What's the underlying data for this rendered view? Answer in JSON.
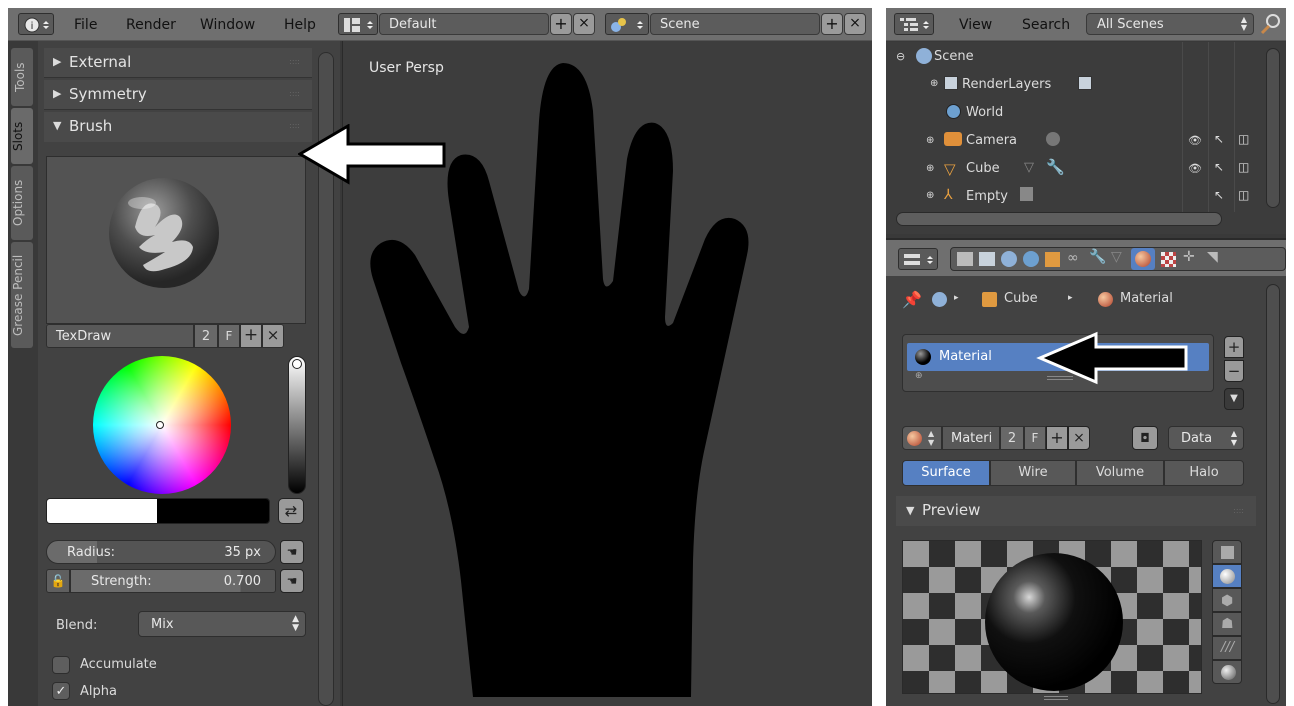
{
  "left_window": {
    "menu": [
      "File",
      "Render",
      "Window",
      "Help"
    ],
    "layout_name": "Default",
    "scene_name": "Scene",
    "tool_tabs": [
      "Tools",
      "Slots",
      "Options",
      "Grease Pencil"
    ],
    "panels": {
      "external": "External",
      "symmetry": "Symmetry",
      "brush": "Brush"
    },
    "brush": {
      "name": "TexDraw",
      "users": "2",
      "fake_user": "F",
      "radius_label": "Radius:",
      "radius_value": "35 px",
      "strength_label": "Strength:",
      "strength_value": "0.700",
      "blend_label": "Blend:",
      "blend_value": "Mix",
      "accumulate_label": "Accumulate",
      "alpha_label": "Alpha"
    },
    "viewport_label": "User Persp"
  },
  "right_window": {
    "outliner_menu": [
      "View",
      "Search"
    ],
    "outliner_filter": "All Scenes",
    "outliner_items": {
      "scene": "Scene",
      "renderlayers": "RenderLayers",
      "world": "World",
      "camera": "Camera",
      "cube": "Cube",
      "empty": "Empty"
    },
    "breadcrumb": {
      "object": "Cube",
      "material": "Material"
    },
    "material_slot": "Material",
    "material_datablock": {
      "name": "Materi",
      "users": "2",
      "fake_user": "F",
      "link": "Data"
    },
    "material_tabs": [
      "Surface",
      "Wire",
      "Volume",
      "Halo"
    ],
    "preview_title": "Preview"
  },
  "colors": {
    "header_bg": "#6f6f6f",
    "panel_bg": "#393939",
    "viewport_bg": "#3d3d3d",
    "selection_blue": "#5680c2",
    "hand_silhouette": "#000000"
  }
}
